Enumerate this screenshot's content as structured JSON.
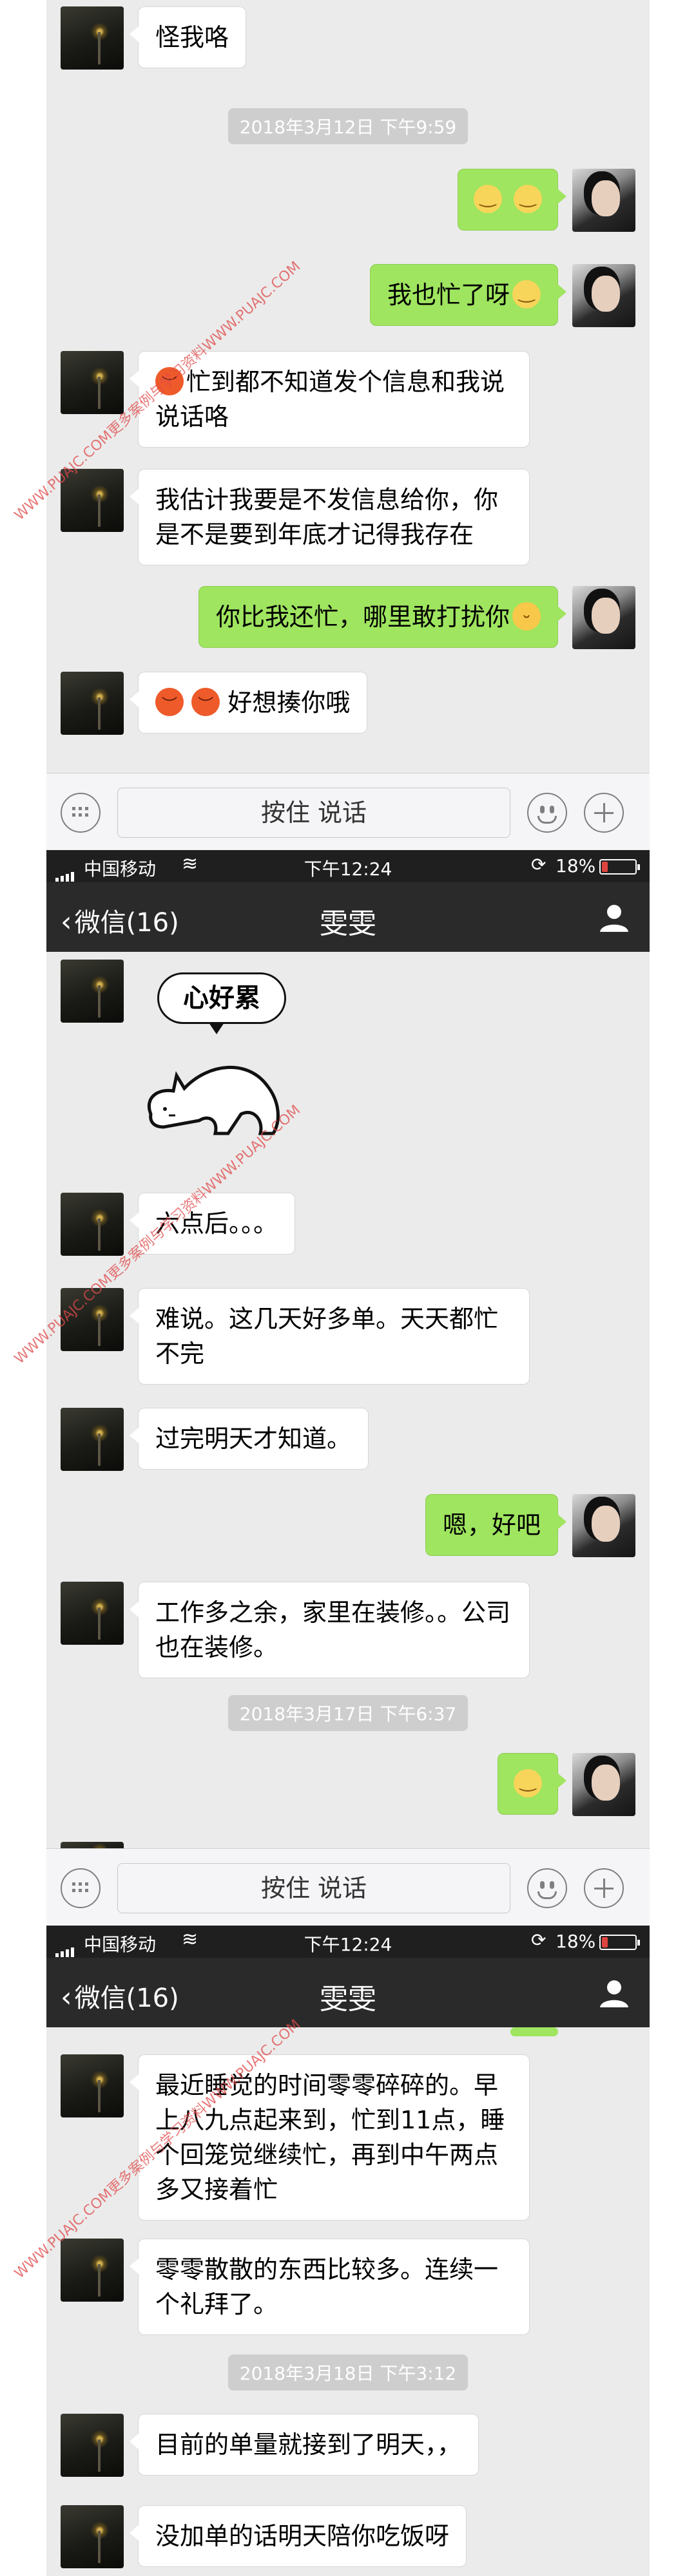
{
  "status_bar": {
    "carrier": "中国移动",
    "time": "下午12:24",
    "battery": "18%",
    "battery_level": 0.18
  },
  "nav": {
    "back_label": "微信(16)",
    "title": "雯雯"
  },
  "input_bar": {
    "hold_to_talk": "按住 说话"
  },
  "screen1": {
    "messages": [
      {
        "type": "in",
        "text": "怪我咯"
      },
      {
        "type": "time",
        "text": "2018年3月12日 下午9:59"
      },
      {
        "type": "out",
        "text": ""
      },
      {
        "type": "out",
        "text": "我也忙了呀"
      },
      {
        "type": "in",
        "text": "忙到都不知道发个信息和我说说话咯"
      },
      {
        "type": "in",
        "text": "我估计我要是不发信息给你，你是不是要到年底才记得我存在"
      },
      {
        "type": "out",
        "text": "你比我还忙，哪里敢打扰你"
      },
      {
        "type": "in",
        "text": "好想揍你哦"
      }
    ]
  },
  "screen2": {
    "sticker_text": "心好累",
    "messages": [
      {
        "type": "in",
        "text": "六点后。。。"
      },
      {
        "type": "in",
        "text": "难说。这几天好多单。天天都忙不完"
      },
      {
        "type": "in",
        "text": "过完明天才知道。"
      },
      {
        "type": "out",
        "text": "嗯，好吧"
      },
      {
        "type": "in",
        "text": "工作多之余，家里在装修。。公司也在装修。"
      },
      {
        "type": "time",
        "text": "2018年3月17日 下午6:37"
      },
      {
        "type": "out",
        "text": ""
      }
    ]
  },
  "screen3": {
    "messages": [
      {
        "type": "in",
        "text": "最近睡觉的时间零零碎碎的。早上八九点起来到，忙到11点，睡个回笼觉继续忙，再到中午两点多又接着忙"
      },
      {
        "type": "in",
        "text": "零零散散的东西比较多。连续一个礼拜了。"
      },
      {
        "type": "time",
        "text": "2018年3月18日 下午3:12"
      },
      {
        "type": "in",
        "text": "目前的单量就接到了明天，，"
      },
      {
        "type": "in",
        "text": "没加单的话明天陪你吃饭呀"
      }
    ]
  },
  "watermark": "WWW.PUAJC.COM更多案例与学习资料WWW.PUAJC.COM",
  "colors": {
    "chat_bg": "#ebebeb",
    "out_bubble": "#9fe55f",
    "in_bubble": "#ffffff",
    "nav_bg": "#2a2a2a",
    "status_bg": "#1f1f1f",
    "battery_low": "#e0443e"
  },
  "icons": [
    "signal-icon",
    "wifi-icon",
    "rotation-lock-icon",
    "battery-icon",
    "back-chevron-icon",
    "contact-icon",
    "keyboard-icon",
    "emoji-icon",
    "plus-icon"
  ]
}
